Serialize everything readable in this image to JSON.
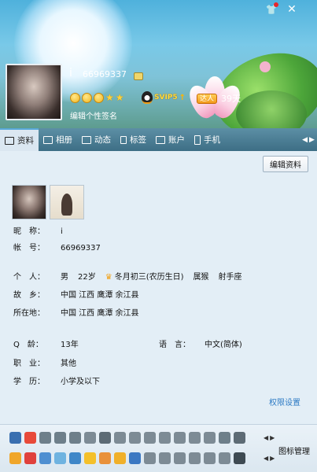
{
  "header": {
    "nickname": "i",
    "qq_number": "66969337",
    "svip_label": "SVIP5",
    "daren_label": "达人",
    "daren_days": "39天",
    "signature_placeholder": "编辑个性签名",
    "level_icons": [
      "sun-face-icon",
      "sun-face-icon",
      "sun-face-icon",
      "star-icon",
      "star-icon"
    ],
    "accent_color": "#f29c12"
  },
  "tabs": [
    {
      "label": "资料",
      "icon": "profile-card-icon",
      "active": true
    },
    {
      "label": "相册",
      "icon": "photo-icon",
      "active": false
    },
    {
      "label": "动态",
      "icon": "list-icon",
      "active": false
    },
    {
      "label": "标签",
      "icon": "bookmark-icon",
      "active": false
    },
    {
      "label": "账户",
      "icon": "wallet-icon",
      "active": false
    },
    {
      "label": "手机",
      "icon": "phone-icon",
      "active": false
    }
  ],
  "profile": {
    "edit_button": "编辑资料",
    "nickname_label": "昵　称：",
    "nickname_value": "i",
    "account_label": "帐　号：",
    "account_value": "66969337",
    "personal_label": "个　人：",
    "gender": "男",
    "age": "22岁",
    "birthday": "冬月初三(农历生日)",
    "zodiac": "属猴",
    "constellation": "射手座",
    "hometown_label": "故　乡：",
    "hometown_value": "中国 江西 鹰潭 余江县",
    "location_label": "所在地：",
    "location_value": "中国 江西 鹰潭 余江县",
    "qage_label": "Q　龄：",
    "qage_value": "13年",
    "language_label": "语　言：",
    "language_value": "中文(简体)",
    "job_label": "职　业：",
    "job_value": "其他",
    "education_label": "学　历：",
    "education_value": "小学及以下",
    "permission_link": "权限设置"
  },
  "iconbar": {
    "manage_label": "图标管理"
  }
}
